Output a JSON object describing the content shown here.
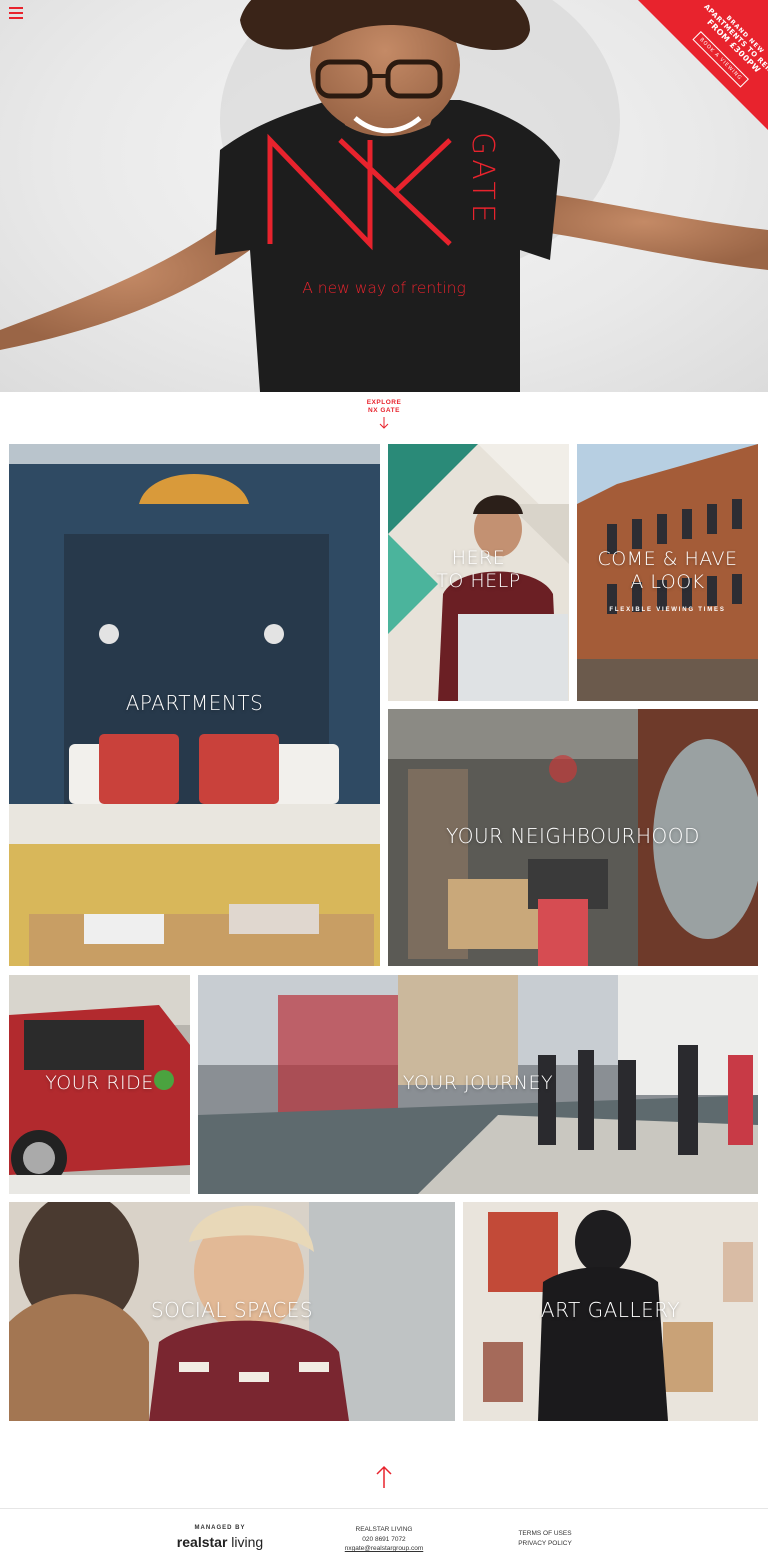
{
  "hero": {
    "tagline": "A new way of renting",
    "logo": {
      "letters": "NX",
      "word": "GATE"
    },
    "badge": {
      "line1": "BRAND NEW",
      "line2": "APARTMENTS TO RENT",
      "line3": "FROM £300PW",
      "button": "BOOK A VIEWING"
    }
  },
  "explore": {
    "line1": "EXPLORE",
    "line2": "NX GATE"
  },
  "tiles": {
    "apartments": "APARTMENTS",
    "here_to_help_1": "HERE",
    "here_to_help_2": "TO HELP",
    "come_look_1": "COME & HAVE",
    "come_look_2": "A LOOK",
    "come_look_sub": "FLEXIBLE VIEWING TIMES",
    "neighbourhood": "YOUR NEIGHBOURHOOD",
    "ride": "YOUR RIDE",
    "journey": "YOUR JOURNEY",
    "social": "SOCIAL SPACES",
    "gallery": "ART GALLERY"
  },
  "footer": {
    "managed_by": "MANAGED BY",
    "brand_bold": "realstar",
    "brand_light": " living",
    "company": "REALSTAR LIVING",
    "phone": "020 8691 7072",
    "email": "nxgate@realstargroup.com",
    "terms": "TERMS OF USES",
    "privacy": "PRIVACY POLICY"
  },
  "colors": {
    "accent": "#e8232d"
  },
  "icons": [
    "menu-icon",
    "arrow-down-icon",
    "arrow-up-icon"
  ]
}
